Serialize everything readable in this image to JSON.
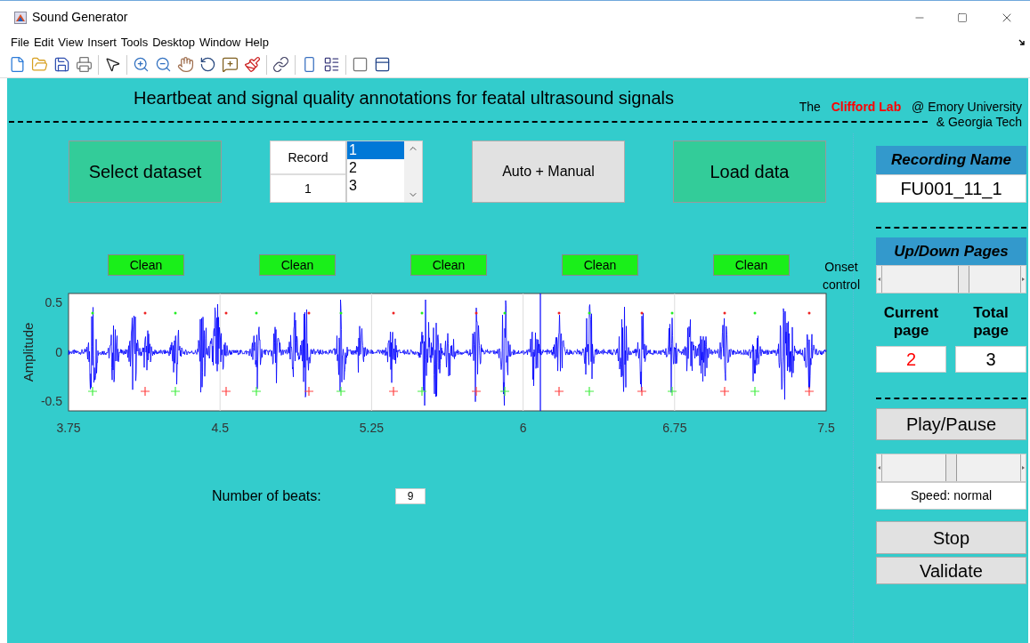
{
  "window": {
    "title": "Sound Generator"
  },
  "menu": [
    "File",
    "Edit",
    "View",
    "Insert",
    "Tools",
    "Desktop",
    "Window",
    "Help"
  ],
  "header": {
    "title": "Heartbeat and signal quality annotations for featal ultrasound signals",
    "credit_prefix": "The",
    "credit_lab": "Clifford Lab",
    "credit_suffix": "@ Emory University",
    "credit_line2": "& Georgia Tech"
  },
  "dataset_button": "Select dataset",
  "record_table": {
    "header": "Record",
    "value": "1"
  },
  "record_list": [
    {
      "label": "1",
      "selected": true
    },
    {
      "label": "2",
      "selected": false
    },
    {
      "label": "3",
      "selected": false
    }
  ],
  "mode_button": "Auto + Manual",
  "load_button": "Load data",
  "quality_labels": [
    "Clean",
    "Clean",
    "Clean",
    "Clean",
    "Clean"
  ],
  "onset_label": "Onset control",
  "plot": {
    "ylabel": "Amplitude",
    "yticks": [
      "0.5",
      "0",
      "-0.5"
    ],
    "xticks": [
      "3.75",
      "4.5",
      "5.25",
      "6",
      "6.75",
      "7.5"
    ]
  },
  "beats": {
    "label": "Number of beats:",
    "value": "9"
  },
  "recording": {
    "header": "Recording Name",
    "value": "FU001_11_1"
  },
  "pages": {
    "header": "Up/Down Pages",
    "level": 0.6,
    "current_label": "Current page",
    "total_label": "Total page",
    "current": "2",
    "total": "3"
  },
  "play_button": "Play/Pause",
  "speed": {
    "level": 0.5,
    "label": "Speed: normal"
  },
  "stop_button": "Stop",
  "validate_button": "Validate"
}
